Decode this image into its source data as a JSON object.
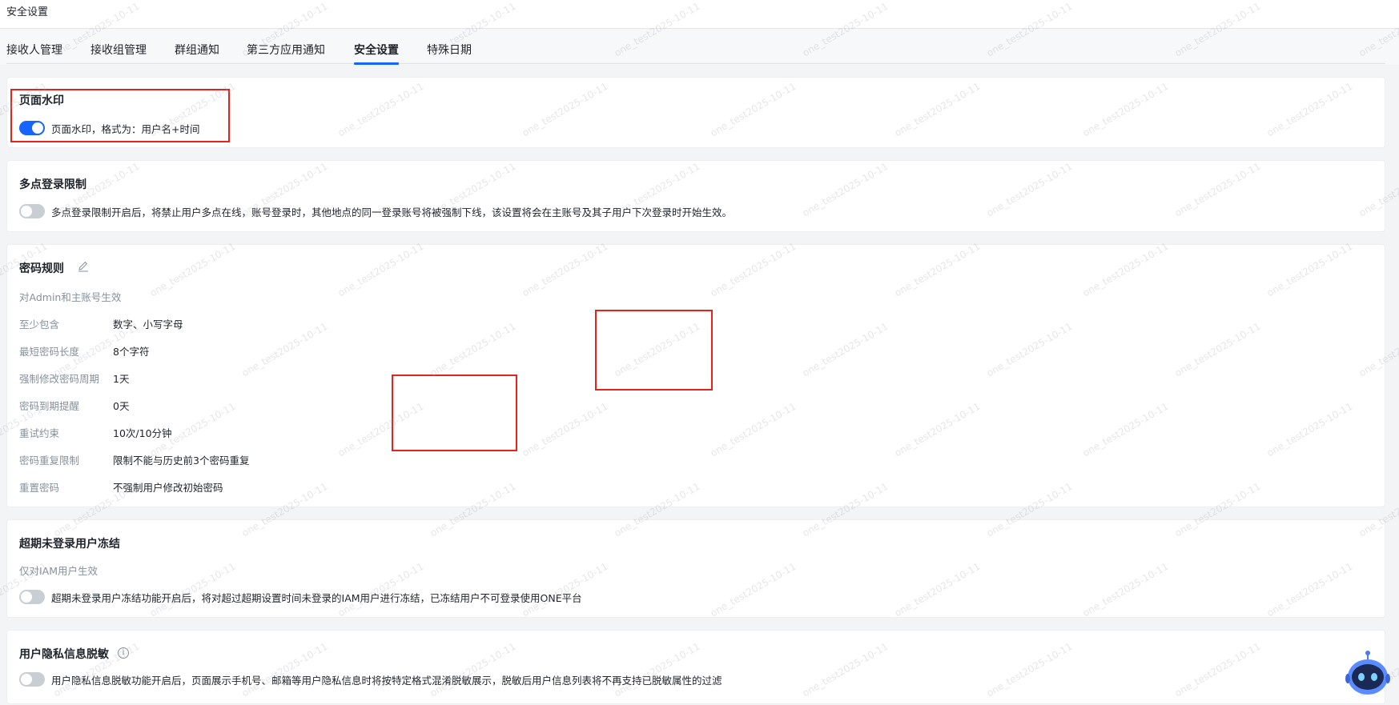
{
  "header": {
    "title": "安全设置"
  },
  "tabs": [
    {
      "label": "接收人管理"
    },
    {
      "label": "接收组管理"
    },
    {
      "label": "群组通知"
    },
    {
      "label": "第三方应用通知"
    },
    {
      "label": "安全设置",
      "active": true
    },
    {
      "label": "特殊日期"
    }
  ],
  "watermark": {
    "title": {
      "label": "页面水印"
    },
    "switch": {
      "on": true,
      "label": "页面水印，格式为：用户名+时间"
    }
  },
  "multi_login": {
    "title": "多点登录限制",
    "switch": {
      "on": false,
      "label": "多点登录限制开启后，将禁止用户多点在线，账号登录时，其他地点的同一登录账号将被强制下线，该设置将会在主账号及其子用户下次登录时开始生效。"
    }
  },
  "password_rules": {
    "title": "密码规则",
    "scope": "对Admin和主账号生效",
    "rows": [
      {
        "key": "至少包含",
        "value": "数字、小写字母"
      },
      {
        "key": "最短密码长度",
        "value": "8个字符"
      },
      {
        "key": "强制修改密码周期",
        "value": "1天"
      },
      {
        "key": "密码到期提醒",
        "value": "0天"
      },
      {
        "key": "重试约束",
        "value": "10次/10分钟"
      },
      {
        "key": "密码重复限制",
        "value": "限制不能与历史前3个密码重复"
      },
      {
        "key": "重置密码",
        "value": "不强制用户修改初始密码"
      }
    ]
  },
  "inactive_freeze": {
    "title": "超期未登录用户冻结",
    "scope": "仅对IAM用户生效",
    "switch": {
      "on": false,
      "label": "超期未登录用户冻结功能开启后，将对超过超期设置时间未登录的IAM用户进行冻结，已冻结用户不可登录使用ONE平台"
    }
  },
  "privacy_mask": {
    "title": "用户隐私信息脱敏",
    "switch": {
      "on": false,
      "label": "用户隐私信息脱敏功能开启后，页面展示手机号、邮箱等用户隐私信息时将按特定格式混淆脱敏展示，脱敏后用户信息列表将不再支持已脱敏属性的过滤"
    }
  },
  "background_watermark_text": "one_test2025-10-11",
  "colors": {
    "accent": "#1664ff",
    "annotation": "#e5231d"
  },
  "icons": {
    "edit": "edit-icon",
    "info": "info-icon",
    "assistant": "robot-assistant-icon"
  }
}
